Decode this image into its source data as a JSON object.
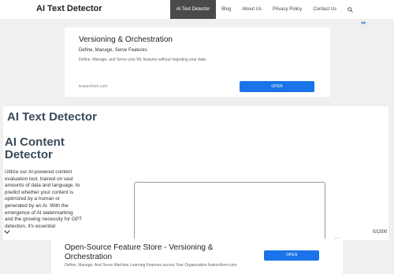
{
  "header": {
    "brand": "AI Text Detector",
    "nav": [
      "AI Text Detector",
      "Blog",
      "About Us",
      "Privacy Policy",
      "Contact Us"
    ],
    "search_icon": "search-icon"
  },
  "ad_top": {
    "title": "Versioning & Orchestration",
    "subtitle": "Define, Manage, Serve Features",
    "description": "Define, Manage, and Serve your ML features without migrating your data.",
    "domain": "featureform.com",
    "button": "OPEN",
    "choices_icon": "ad-choices-icon"
  },
  "main": {
    "page_title": "AI Text Detector",
    "section_title": "AI Content Detector",
    "description": "Utilize our AI-powered content evaluation tool, trained on vast amounts of data and language, to predict whether your content is optimized by a human or generated by an AI. With the emergence of AI watermarking and the growing necessity for GPT detection, it's essential",
    "textarea_value": "",
    "counter": "0/1500"
  },
  "ad_bottom": {
    "title": "Open-Source Feature Store - Versioning & Orchestration",
    "description": "Define, Manage, And Serve Machine Learning Features across Your Organization featureform.com",
    "button": "OPEN",
    "choices_icon": "ad-choices-icon"
  },
  "colors": {
    "accent_blue": "#1a73e8",
    "heading": "#3a4a5a",
    "nav_active_bg": "#4a4a4a"
  }
}
